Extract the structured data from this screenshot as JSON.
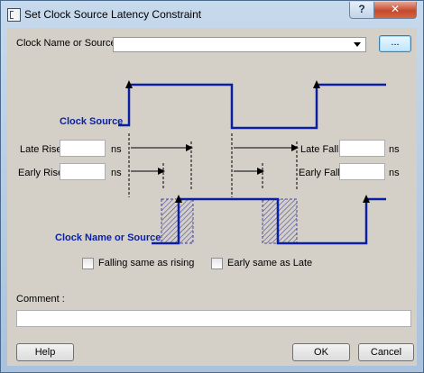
{
  "window": {
    "title": "Set Clock Source Latency Constraint",
    "help_glyph": "?",
    "close_glyph": "✕"
  },
  "clock": {
    "label": "Clock Name or Source:",
    "value": "",
    "browse_label": "..."
  },
  "diagram": {
    "clock_source_label": "Clock Source",
    "clock_name_label": "Clock Name or Source"
  },
  "latency": {
    "late_rise_label": "Late Rise",
    "early_rise_label": "Early Rise",
    "late_fall_label": "Late Fall",
    "early_fall_label": "Early Fall",
    "unit": "ns",
    "late_rise_value": "",
    "early_rise_value": "",
    "late_fall_value": "",
    "early_fall_value": ""
  },
  "options": {
    "falling_same": "Falling same as rising",
    "falling_same_checked": false,
    "early_same": "Early same as Late",
    "early_same_checked": false
  },
  "comment": {
    "label": "Comment :",
    "value": ""
  },
  "buttons": {
    "help": "Help",
    "ok": "OK",
    "cancel": "Cancel"
  },
  "colors": {
    "waveform": "#0a1fa3",
    "hatch": "#4a4aa0",
    "title_close": "#c44a2c"
  }
}
